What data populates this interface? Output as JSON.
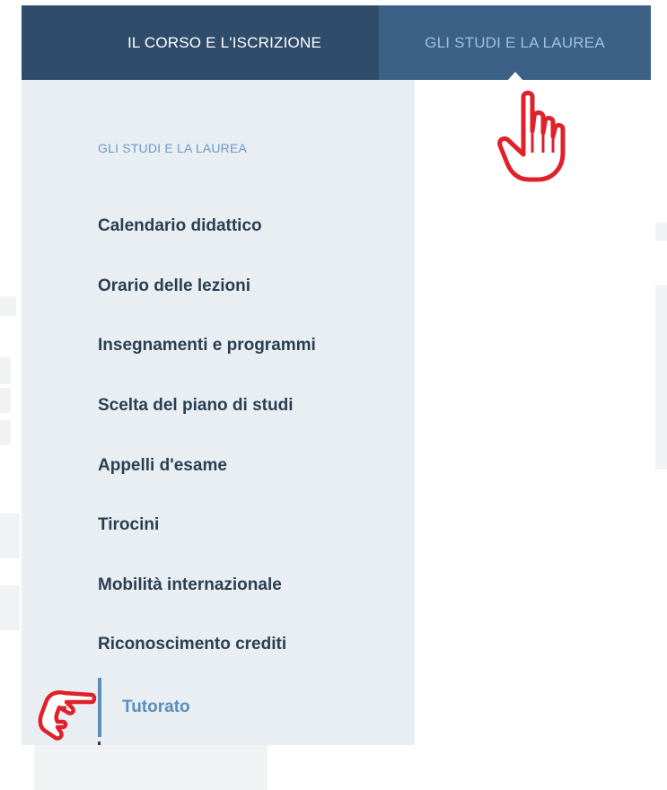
{
  "nav": {
    "tabs": [
      {
        "label": "IL CORSO E L'ISCRIZIONE",
        "active": false
      },
      {
        "label": "GLI STUDI E LA LAUREA",
        "active": true
      }
    ]
  },
  "dropdown": {
    "heading": "GLI STUDI E LA LAUREA",
    "items": [
      {
        "label": "Calendario didattico"
      },
      {
        "label": "Orario delle lezioni"
      },
      {
        "label": "Insegnamenti e programmi"
      },
      {
        "label": "Scelta del piano di studi"
      },
      {
        "label": "Appelli d'esame"
      },
      {
        "label": "Tirocini"
      },
      {
        "label": "Mobilità internazionale"
      },
      {
        "label": "Riconoscimento crediti"
      },
      {
        "label": "Tutorato",
        "active": true
      }
    ]
  },
  "colors": {
    "nav_bg": "#2f4d6b",
    "active_tab_bg": "#3c6186",
    "active_tab_text": "#9cc0e1",
    "dropdown_bg": "#e9eef3",
    "heading_text": "#6a9ac8",
    "item_text": "#2a3e52",
    "active_item": "#5b8dbd",
    "cursor_hand": "#e0202a"
  },
  "icons": {
    "pointer_top": "hand-pointer-up-icon",
    "pointer_left": "hand-pointer-right-icon"
  }
}
